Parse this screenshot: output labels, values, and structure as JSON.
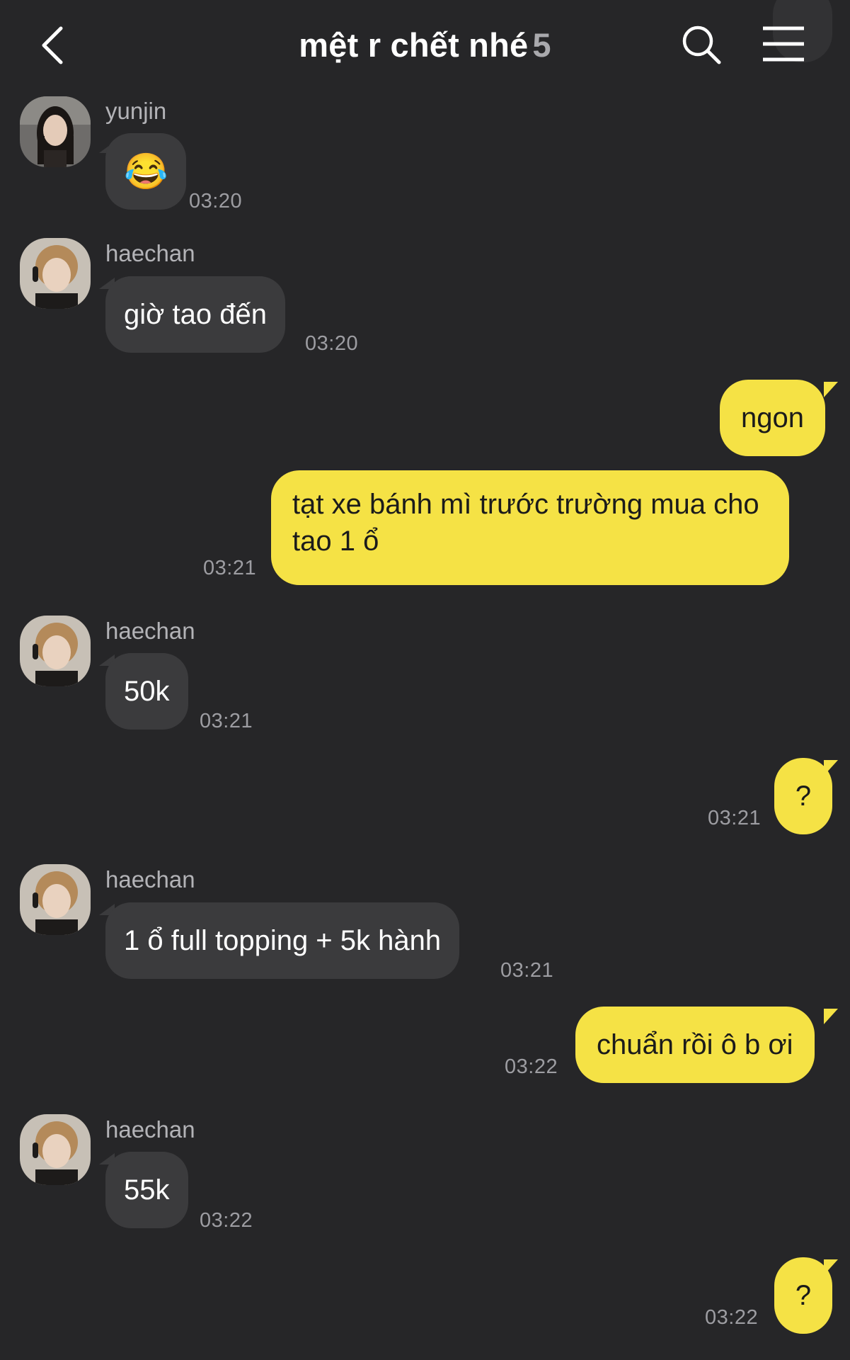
{
  "header": {
    "title": "mệt r chết nhé",
    "member_count": "5"
  },
  "messages": [
    {
      "sender": "yunjin",
      "text": "😂",
      "time": "03:20"
    },
    {
      "sender": "haechan",
      "text": "giờ tao đến",
      "time": "03:20"
    },
    {
      "text": "ngon"
    },
    {
      "text": "tạt xe bánh mì trước trường mua cho",
      "text2": "tao 1 ổ",
      "time": "03:21"
    },
    {
      "sender": "haechan",
      "text": "50k",
      "time": "03:21"
    },
    {
      "text": "?",
      "time": "03:21"
    },
    {
      "sender": "haechan",
      "text": "1 ổ full topping + 5k hành",
      "time": "03:21"
    },
    {
      "text": "chuẩn rồi ô b ơi",
      "time": "03:22"
    },
    {
      "sender": "haechan",
      "text": "55k",
      "time": "03:22"
    },
    {
      "text": "?",
      "time": "03:22"
    }
  ],
  "icons": {
    "back": "chevron-left-icon",
    "search": "search-icon",
    "menu": "menu-icon"
  },
  "colors": {
    "background": "#262628",
    "received_bubble": "#3b3b3d",
    "sent_bubble": "#f5e245"
  }
}
